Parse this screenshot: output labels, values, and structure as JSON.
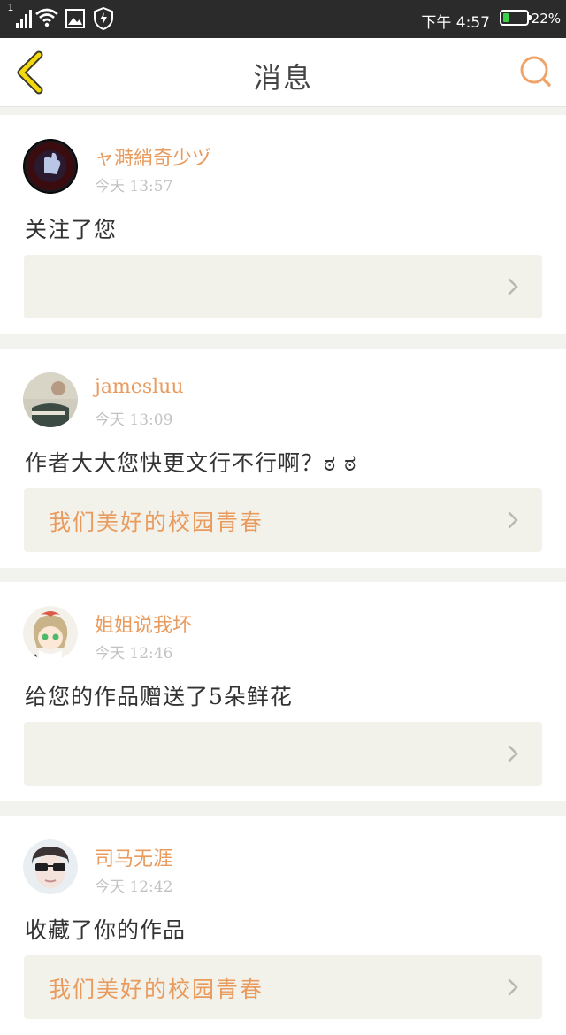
{
  "status_bar": {
    "sim_label": "1",
    "time": "下午 4:57",
    "battery_percent": "22%",
    "battery_level": 0.22,
    "icons": [
      "signal-icon",
      "wifi-icon",
      "gallery-icon",
      "shield-icon",
      "battery-icon"
    ]
  },
  "header": {
    "title": "消息",
    "back_icon": "chevron-left-icon",
    "search_icon": "search-icon"
  },
  "colors": {
    "accent": "#e99a5d",
    "back_arrow": "#f5d90c",
    "battery": "#3ecf4a"
  },
  "messages": [
    {
      "username": "ャ溡綃奇少ヅ",
      "time": "今天 13:57",
      "text": "关注了您",
      "work_title": ""
    },
    {
      "username": "jamesluu",
      "time": "今天 13:09",
      "text": "作者大大您快更文行不行啊？ಠ ಠ",
      "work_title": "我们美好的校园青春"
    },
    {
      "username": "姐姐说我坏",
      "time": "今天 12:46",
      "text": "给您的作品赠送了5朵鲜花",
      "work_title": ""
    },
    {
      "username": "司马无涯",
      "time": "今天 12:42",
      "text": "收藏了你的作品",
      "work_title": "我们美好的校园青春"
    }
  ]
}
